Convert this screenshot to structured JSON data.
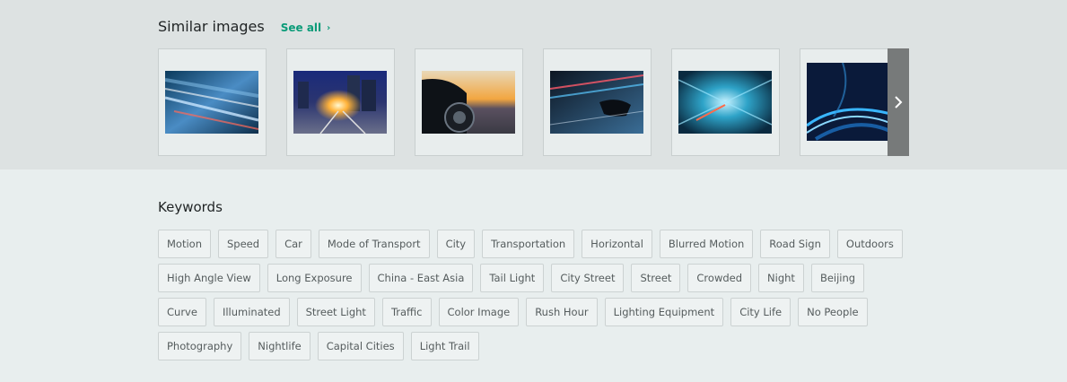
{
  "similar": {
    "title": "Similar images",
    "see_all_label": "See all",
    "images": [
      {
        "name": "highway-traffic-motion-image"
      },
      {
        "name": "city-street-headlight-image"
      },
      {
        "name": "car-wheel-speed-image"
      },
      {
        "name": "car-mirror-night-image"
      },
      {
        "name": "tunnel-light-trail-image"
      },
      {
        "name": "blue-light-trail-curve-image"
      }
    ]
  },
  "keywords": {
    "title": "Keywords",
    "items": [
      "Motion",
      "Speed",
      "Car",
      "Mode of Transport",
      "City",
      "Transportation",
      "Horizontal",
      "Blurred Motion",
      "Road Sign",
      "Outdoors",
      "High Angle View",
      "Long Exposure",
      "China - East Asia",
      "Tail Light",
      "City Street",
      "Street",
      "Crowded",
      "Night",
      "Beijing",
      "Curve",
      "Illuminated",
      "Street Light",
      "Traffic",
      "Color Image",
      "Rush Hour",
      "Lighting Equipment",
      "City Life",
      "No People",
      "Photography",
      "Nightlife",
      "Capital Cities",
      "Light Trail"
    ]
  }
}
